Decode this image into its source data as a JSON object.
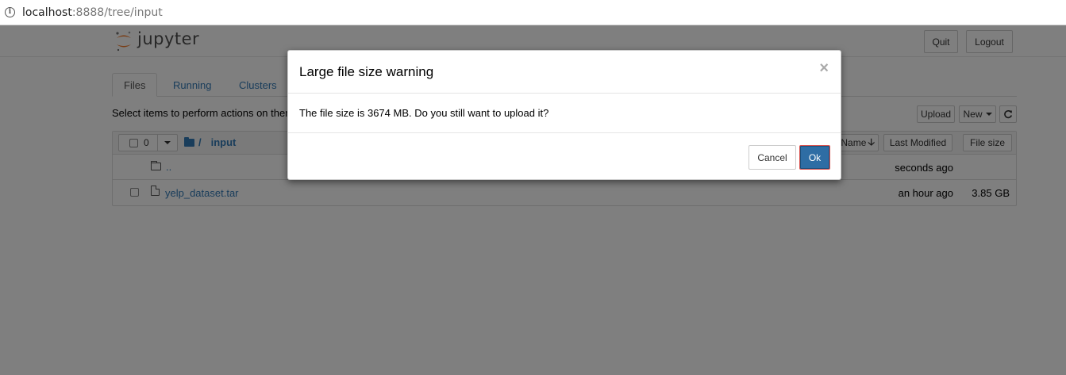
{
  "browser": {
    "url_host": "localhost",
    "url_rest": ":8888/tree/input"
  },
  "header": {
    "logo_text": "jupyter",
    "quit_label": "Quit",
    "logout_label": "Logout"
  },
  "tabs": [
    {
      "label": "Files",
      "active": true
    },
    {
      "label": "Running",
      "active": false
    },
    {
      "label": "Clusters",
      "active": false
    }
  ],
  "toolbar": {
    "select_info": "Select items to perform actions on them.",
    "upload_label": "Upload",
    "new_label": "New",
    "refresh_icon": "refresh-icon"
  },
  "listing": {
    "selected_count": "0",
    "breadcrumb_root": "/",
    "breadcrumb_folder": "input",
    "columns": {
      "name": "Name",
      "last_modified": "Last Modified",
      "file_size": "File size"
    },
    "rows": [
      {
        "name": "..",
        "modified": "seconds ago",
        "size": ""
      },
      {
        "name": "yelp_dataset.tar",
        "modified": "an hour ago",
        "size": "3.85 GB"
      }
    ]
  },
  "modal": {
    "title": "Large file size warning",
    "body": "The file size is 3674 MB. Do you still want to upload it?",
    "close_symbol": "×",
    "cancel_label": "Cancel",
    "ok_label": "Ok"
  },
  "colors": {
    "link": "#337ab7",
    "ok_button": "#2e6da4",
    "logo_orange": "#f37726"
  }
}
